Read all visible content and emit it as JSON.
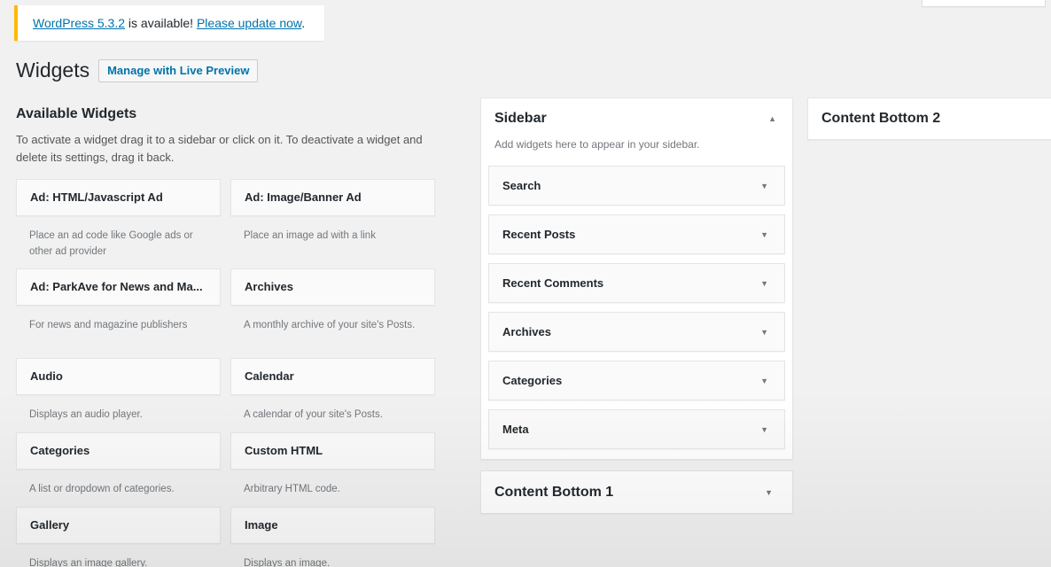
{
  "update_nag": {
    "version_link": "WordPress 5.3.2",
    "middle_text": " is available! ",
    "update_link": "Please update now",
    "end_text": "."
  },
  "header": {
    "title": "Widgets",
    "live_preview_button": "Manage with Live Preview"
  },
  "available_widgets": {
    "title": "Available Widgets",
    "description": "To activate a widget drag it to a sidebar or click on it. To deactivate a widget and delete its settings, drag it back.",
    "items": [
      {
        "name": "Ad: HTML/Javascript Ad",
        "description": "Place an ad code like Google ads or other ad provider"
      },
      {
        "name": "Ad: Image/Banner Ad",
        "description": "Place an image ad with a link"
      },
      {
        "name": "Ad: ParkAve for News and Ma...",
        "description": "For news and magazine publishers"
      },
      {
        "name": "Archives",
        "description": "A monthly archive of your site's Posts."
      },
      {
        "name": "Audio",
        "description": "Displays an audio player."
      },
      {
        "name": "Calendar",
        "description": "A calendar of your site's Posts."
      },
      {
        "name": "Categories",
        "description": "A list or dropdown of categories."
      },
      {
        "name": "Custom HTML",
        "description": "Arbitrary HTML code."
      },
      {
        "name": "Gallery",
        "description": "Displays an image gallery."
      },
      {
        "name": "Image",
        "description": "Displays an image."
      }
    ]
  },
  "sidebar_area": {
    "title": "Sidebar",
    "description": "Add widgets here to appear in your sidebar.",
    "toggle_icon": "caret-up-icon",
    "widgets": [
      {
        "name": "Search"
      },
      {
        "name": "Recent Posts"
      },
      {
        "name": "Recent Comments"
      },
      {
        "name": "Archives"
      },
      {
        "name": "Categories"
      },
      {
        "name": "Meta"
      }
    ]
  },
  "content_bottom_1": {
    "title": "Content Bottom 1",
    "toggle_icon": "caret-down-icon"
  },
  "content_bottom_2": {
    "title": "Content Bottom 2"
  },
  "colors": {
    "link": "#0073aa",
    "nag_border": "#ffb900",
    "background": "#f1f1f1"
  }
}
